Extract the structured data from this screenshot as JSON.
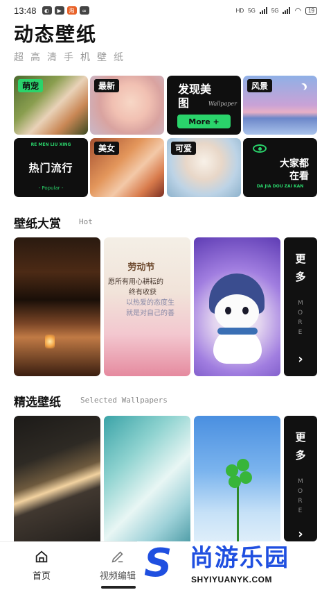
{
  "status_bar": {
    "time": "13:48",
    "network_labels": [
      "HD",
      "5G",
      "5G"
    ],
    "battery": "19"
  },
  "header": {
    "title": "动态壁纸",
    "subtitle": "超高清手机壁纸"
  },
  "categories": {
    "pet": "萌宠",
    "new": "最新",
    "discover": {
      "title": "发现美图",
      "sub": "Wallpaper",
      "button": "More +"
    },
    "scenery": "风景",
    "hot": {
      "top": "RE MEN LIU XING",
      "main": "热门流行",
      "bottom": "- Popular -"
    },
    "beauty": "美女",
    "cute": "可爱",
    "watching": {
      "main": "大家都在看",
      "bottom": "DA JIA DOU ZAI KAN"
    }
  },
  "section_hot": {
    "title": "壁纸大赏",
    "sub": "Hot",
    "more_main": "更多",
    "more_sub": "MORE",
    "more_arrow": "›"
  },
  "poem": {
    "title": "劳动节",
    "line1": "愿所有用心耕耘的",
    "line2": "终有收获",
    "line3": "以热爱的态度生",
    "line4": "就是对自己的善"
  },
  "section_selected": {
    "title": "精选壁纸",
    "sub": "Selected Wallpapers",
    "more_main": "更多",
    "more_sub": "MORE",
    "more_arrow": "›"
  },
  "bottom_nav": {
    "home": "首页",
    "video": "视频编辑"
  },
  "watermark": {
    "letter": "S",
    "name": "尚游乐园",
    "url": "SHYIYUANYK.COM"
  },
  "colors": {
    "accent": "#2ad46b",
    "watermark_blue": "#1f4fe0"
  }
}
